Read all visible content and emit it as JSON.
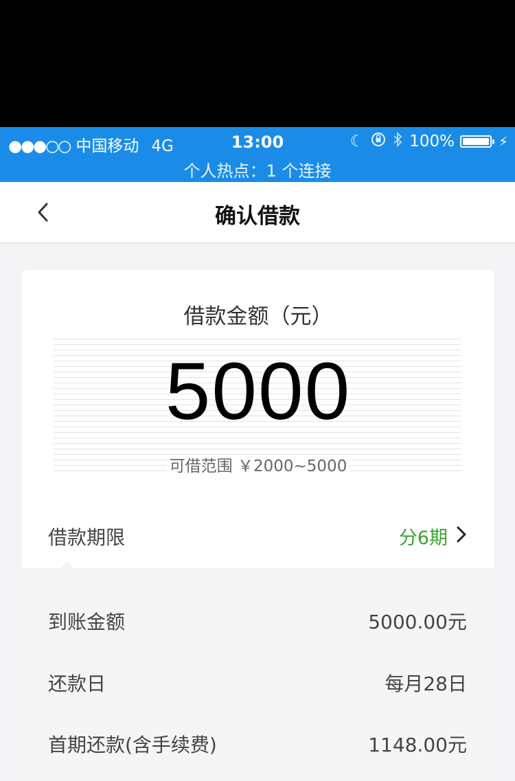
{
  "status_bar": {
    "carrier_signal": "●●●○○",
    "carrier": "中国移动",
    "network": "4G",
    "time": "13:00",
    "battery": "100%",
    "hotspot": "个人热点：1 个连接",
    "icons": [
      "moon-icon",
      "orientation-lock-icon",
      "bluetooth-icon",
      "battery-icon",
      "charging-icon"
    ]
  },
  "nav": {
    "title": "确认借款",
    "back_icon": "chevron-left-icon"
  },
  "loan": {
    "amount_label": "借款金额（元）",
    "amount": "5000",
    "range": "可借范围 ￥2000~5000"
  },
  "term": {
    "label": "借款期限",
    "value": "分6期",
    "value_color": "#3aa335"
  },
  "details": [
    {
      "label": "到账金额",
      "value": "5000.00元"
    },
    {
      "label": "还款日",
      "value": "每月28日"
    },
    {
      "label": "首期还款(含手续费)",
      "value": "1148.00元"
    }
  ],
  "colors": {
    "status_bar": "#1a8ce8",
    "accent_green": "#3aa335"
  }
}
